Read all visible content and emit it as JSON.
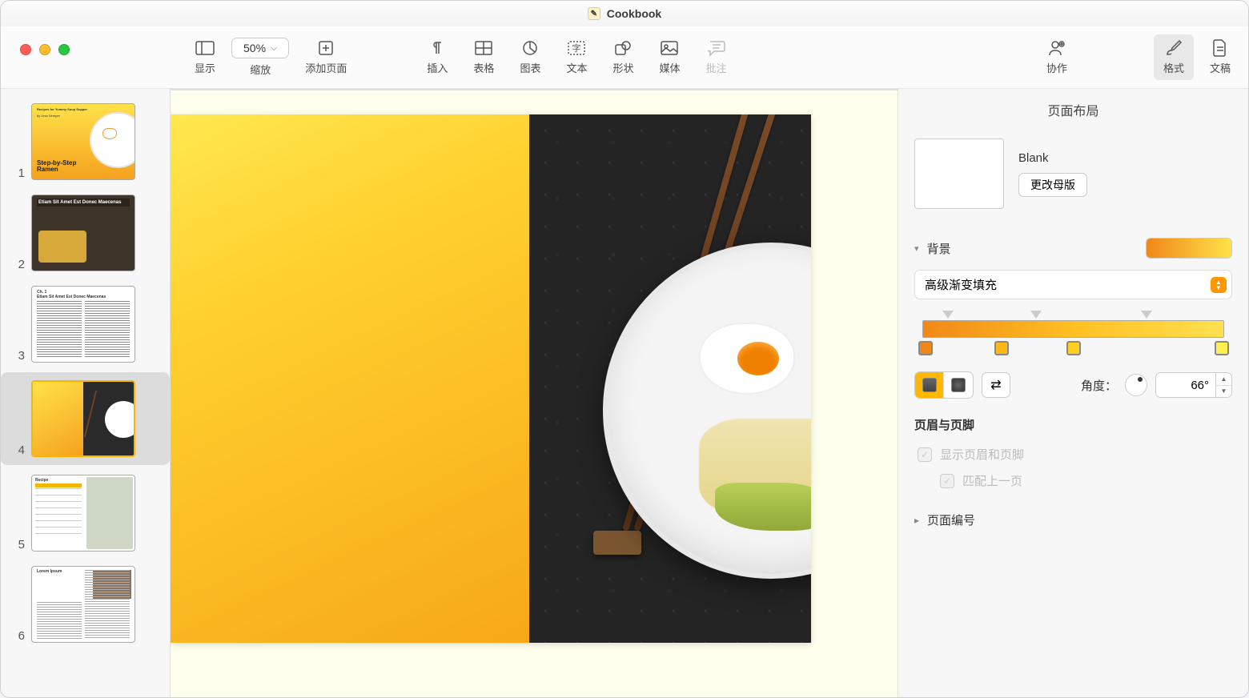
{
  "titlebar": {
    "title": "Cookbook"
  },
  "traffic": {
    "close": "close",
    "min": "min",
    "max": "max"
  },
  "toolbar": {
    "view_label": "显示",
    "zoom_value": "50%",
    "zoom_label": "缩放",
    "addpage_label": "添加页面",
    "insert_label": "插入",
    "table_label": "表格",
    "chart_label": "图表",
    "text_label": "文本",
    "shape_label": "形状",
    "media_label": "媒体",
    "comment_label": "批注",
    "collab_label": "协作",
    "format_label": "格式",
    "document_label": "文稿"
  },
  "thumbs": {
    "p1": "1",
    "p2": "2",
    "p3": "3",
    "p4": "4",
    "p5": "5",
    "p6": "6",
    "t1_subtitle": "Recipes for Yummy Soup Supper",
    "t1_byline": "by Ursa Semper",
    "t1_title": "Step-by-Step\nRamen",
    "t2_title": "Etiam Sit Amet Est Donec Maecenas",
    "t3_ch": "Ch. 1",
    "t3_title": "Etiam Sit Amet Est Donec Maecenas",
    "t5_title": "Recipe",
    "t6_title": "Lorem Ipsum"
  },
  "inspector": {
    "panel_title": "页面布局",
    "master_name": "Blank",
    "change_master_btn": "更改母版",
    "bg_label": "背景",
    "fill_type": "高级渐变填充",
    "angle_label": "角度：",
    "angle_value": "66°",
    "hf_title": "页眉与页脚",
    "hf_show": "显示页眉和页脚",
    "hf_match": "匹配上一页",
    "pagenum_title": "页面编号",
    "gradient_stops": {
      "s1": "#f08818",
      "s2": "#ffb818",
      "s3": "#ffd020",
      "s4": "#ffef50"
    }
  }
}
